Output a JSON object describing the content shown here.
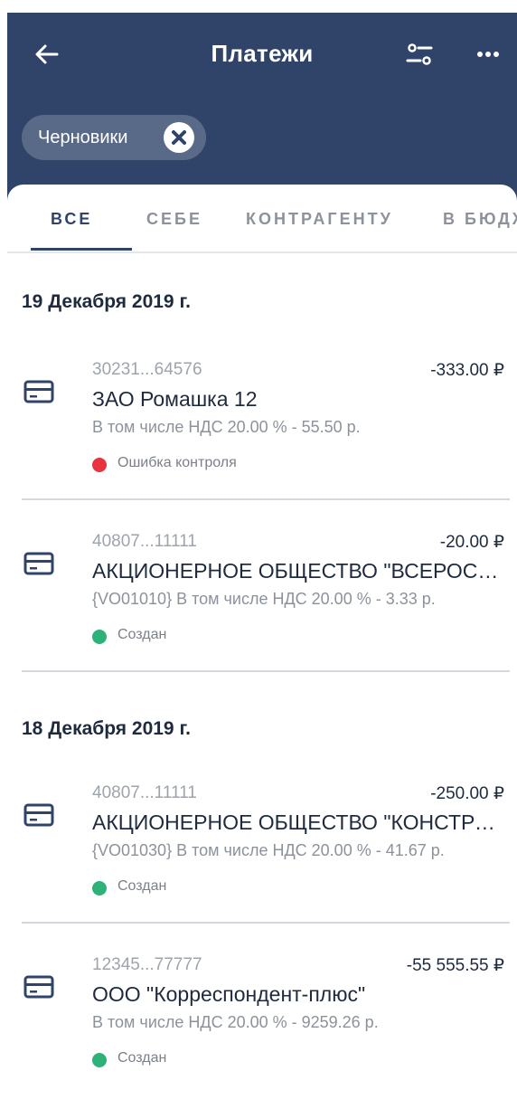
{
  "header": {
    "title": "Платежи",
    "back_icon": "arrow-left-icon",
    "filter_icon": "filter-sliders-icon",
    "more_icon": "more-horizontal-icon",
    "background": "#2f4468"
  },
  "filter_chip": {
    "label": "Черновики",
    "close_icon": "close-circle-icon"
  },
  "tabs": [
    {
      "label": "ВСЕ",
      "active": true
    },
    {
      "label": "СЕБЕ",
      "active": false
    },
    {
      "label": "КОНТРАГЕНТУ",
      "active": false
    },
    {
      "label": "В БЮДЖЕТ",
      "active": false
    }
  ],
  "groups": [
    {
      "date": "19 Декабря 2019 г.",
      "payments": [
        {
          "account": "30231...64576",
          "amount": "-333.00 ₽",
          "name": "ЗАО Ромашка 12",
          "description": "В том числе НДС 20.00 % - 55.50 р.",
          "status": "Ошибка контроля",
          "status_color": "#e8343f",
          "icon": "card-icon"
        },
        {
          "account": "40807...11111",
          "amount": "-20.00 ₽",
          "name": "АКЦИОНЕРНОЕ ОБЩЕСТВО \"ВСЕРОСCИЙСКИЙ\"",
          "description": "{VO01010}  В том числе НДС 20.00 % - 3.33 р.",
          "status": "Создан",
          "status_color": "#2fb27a",
          "icon": "card-icon"
        }
      ]
    },
    {
      "date": "18 Декабря 2019 г.",
      "payments": [
        {
          "account": "40807...11111",
          "amount": "-250.00 ₽",
          "name": "АКЦИОНЕРНОЕ ОБЩЕСТВО \"КОНСТРУКТОР\"",
          "description": "{VO01030}  В том числе НДС 20.00 % - 41.67 р.",
          "status": "Создан",
          "status_color": "#2fb27a",
          "icon": "card-icon"
        },
        {
          "account": "12345...77777",
          "amount": "-55 555.55 ₽",
          "name": "ООО \"Корреспондент-плюс\"",
          "description": "В том числе НДС 20.00 % - 9259.26 р.",
          "status": "Создан",
          "status_color": "#2fb27a",
          "icon": "card-icon"
        }
      ]
    }
  ]
}
